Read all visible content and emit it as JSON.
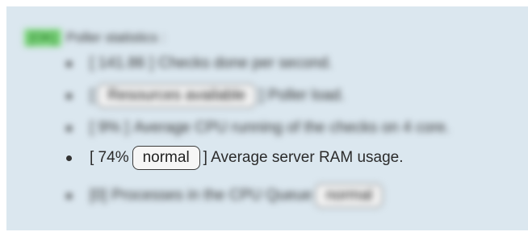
{
  "header": {
    "tag": "[OK]",
    "text": "Poller statistics :"
  },
  "items": [
    {
      "prefix": "[ 141.86 ]",
      "pill": "",
      "suffix": "Checks done per second."
    },
    {
      "prefix": "[",
      "pill": "Resources available",
      "suffix": "] Poller load."
    },
    {
      "prefix": "[ 9% ]",
      "pill": "",
      "suffix": "Average CPU running of the checks on 4 core."
    },
    {
      "prefix": "[ 74%",
      "pill": "normal",
      "suffix": "] Average server RAM usage."
    },
    {
      "prefix": "[0]",
      "pill": "normal",
      "suffix": "Processes in the CPU Queue"
    }
  ]
}
